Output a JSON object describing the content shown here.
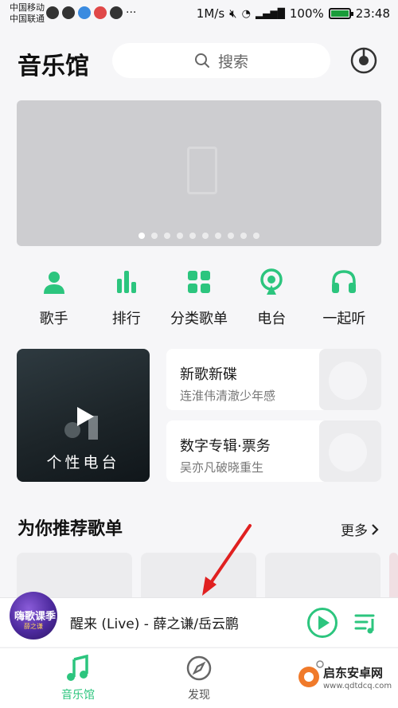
{
  "status_bar": {
    "carrier1": "中国移动",
    "carrier2": "中国联通",
    "net_speed": "1M/s",
    "battery": "100%",
    "time": "23:48"
  },
  "header": {
    "title": "音乐馆",
    "search_placeholder": "搜索",
    "radar_icon": "radar-icon"
  },
  "banner": {
    "dots": 10,
    "active_index": 0
  },
  "quick_nav": [
    {
      "label": "歌手",
      "icon": "singer-icon"
    },
    {
      "label": "排行",
      "icon": "chart-icon"
    },
    {
      "label": "分类歌单",
      "icon": "category-icon"
    },
    {
      "label": "电台",
      "icon": "radio-icon"
    },
    {
      "label": "一起听",
      "icon": "headphones-icon"
    }
  ],
  "radio_card": {
    "label": "个性电台"
  },
  "mini_cards": [
    {
      "title": "新歌新碟",
      "subtitle": "连淮伟清澈少年感"
    },
    {
      "title": "数字专辑·票务",
      "subtitle": "吴亦凡破晓重生"
    }
  ],
  "section": {
    "title": "为你推荐歌单",
    "more": "更多"
  },
  "player": {
    "song": "醒来 (Live) - 薛之谦/岳云鹏",
    "avatar_text": "嗨歌课季",
    "avatar_sub": "薛之谦"
  },
  "tabbar": [
    {
      "label": "音乐馆",
      "active": true
    },
    {
      "label": "发现",
      "active": false
    }
  ],
  "watermark": {
    "name": "启东安卓网",
    "url": "www.qdtdcq.com"
  },
  "colors": {
    "accent": "#2cc57e",
    "annotation": "#e02020"
  }
}
